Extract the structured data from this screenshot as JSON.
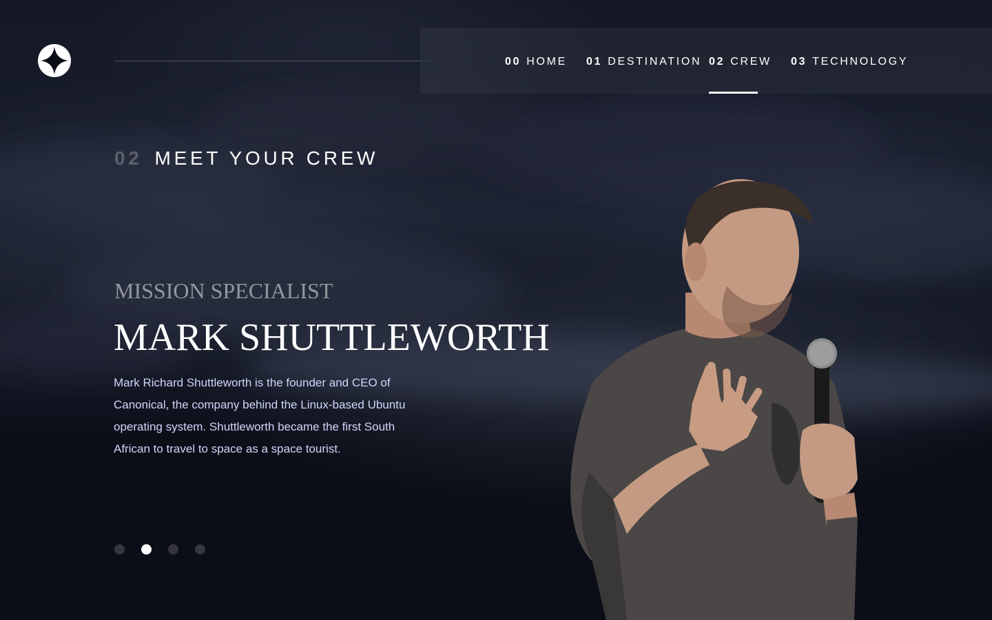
{
  "brand": {
    "logo_icon": "star-logo-icon"
  },
  "nav": {
    "items": [
      {
        "num": "00",
        "label": "HOME",
        "active": false
      },
      {
        "num": "01",
        "label": "DESTINATION",
        "active": false
      },
      {
        "num": "02",
        "label": "CREW",
        "active": true
      },
      {
        "num": "03",
        "label": "TECHNOLOGY",
        "active": false
      }
    ]
  },
  "page": {
    "heading_num": "02",
    "heading": "MEET YOUR CREW"
  },
  "crew": {
    "role": "Mission Specialist",
    "name": "Mark Shuttleworth",
    "bio": "Mark Richard Shuttleworth is the founder and CEO of Canonical, the company behind the Linux-based Ubuntu operating system. Shuttleworth became the first South African to travel to space as a space tourist.",
    "slides_total": 4,
    "active_slide": 2
  },
  "colors": {
    "background": "#0b0d17",
    "text": "#ffffff",
    "bio_text": "#d0d6f9"
  }
}
